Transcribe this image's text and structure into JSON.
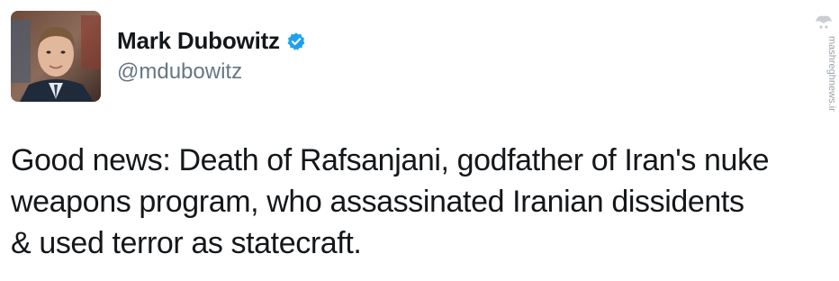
{
  "author": {
    "display_name": "Mark Dubowitz",
    "handle": "@mdubowitz",
    "verified": true,
    "avatar_icon": "person-portrait"
  },
  "tweet": {
    "lines": [
      "Good news: Death of Rafsanjani, godfather of Iran's nuke",
      "weapons program, who assassinated Iranian dissidents",
      "& used terror as statecraft."
    ]
  },
  "watermark": {
    "text": "mashreghnews.ir"
  },
  "colors": {
    "text": "#14171a",
    "handle": "#657786",
    "verified_badge": "#1da1f2"
  }
}
